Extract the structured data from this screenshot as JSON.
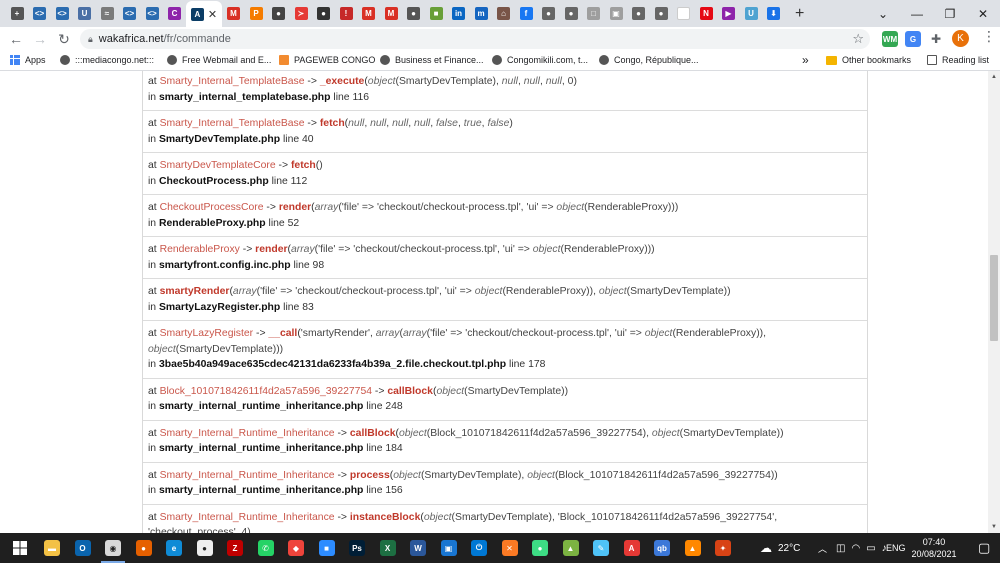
{
  "browser": {
    "active_tab_label": "",
    "tabs": [
      {
        "icon": "tab-icon",
        "color": "#555555",
        "glyph": "+"
      },
      {
        "icon": "code-icon",
        "color": "#2b6cb0",
        "glyph": "<>"
      },
      {
        "icon": "code-icon",
        "color": "#2b6cb0",
        "glyph": "<>"
      },
      {
        "icon": "shield-icon",
        "color": "#4a6fa5",
        "glyph": "U"
      },
      {
        "icon": "cloud-icon",
        "color": "#7a7a7a",
        "glyph": "≈"
      },
      {
        "icon": "code-icon",
        "color": "#2b6cb0",
        "glyph": "<>"
      },
      {
        "icon": "code-icon",
        "color": "#2b6cb0",
        "glyph": "<>"
      },
      {
        "icon": "gradient-icon",
        "color": "#8e24aa",
        "glyph": "C"
      },
      {
        "icon": "azure-icon",
        "color": "#0b3d66",
        "glyph": "A"
      },
      {
        "icon": "gmail-icon",
        "color": "#d93025",
        "glyph": "M"
      },
      {
        "icon": "orange-icon",
        "color": "#f57c00",
        "glyph": "P"
      },
      {
        "icon": "circle-icon",
        "color": "#444444",
        "glyph": "●"
      },
      {
        "icon": "bird-icon",
        "color": "#e53935",
        "glyph": "≻"
      },
      {
        "icon": "circle-icon",
        "color": "#333333",
        "glyph": "●"
      },
      {
        "icon": "red-circle-icon",
        "color": "#c62828",
        "glyph": "!"
      },
      {
        "icon": "gmail-icon",
        "color": "#d93025",
        "glyph": "M"
      },
      {
        "icon": "gmail-icon",
        "color": "#d93025",
        "glyph": "M"
      },
      {
        "icon": "circle-icon",
        "color": "#555555",
        "glyph": "●"
      },
      {
        "icon": "green-square-icon",
        "color": "#689f38",
        "glyph": "■"
      },
      {
        "icon": "linkedin-icon",
        "color": "#0a66c2",
        "glyph": "in"
      },
      {
        "icon": "m-icon",
        "color": "#1565c0",
        "glyph": "m"
      },
      {
        "icon": "house-icon",
        "color": "#795548",
        "glyph": "⌂"
      },
      {
        "icon": "facebook-icon",
        "color": "#1877f2",
        "glyph": "f"
      },
      {
        "icon": "circle-icon",
        "color": "#666666",
        "glyph": "●"
      },
      {
        "icon": "circle-icon",
        "color": "#666666",
        "glyph": "●"
      },
      {
        "icon": "doc-icon",
        "color": "#9e9e9e",
        "glyph": "□"
      },
      {
        "icon": "doc-icon",
        "color": "#9e9e9e",
        "glyph": "▣"
      },
      {
        "icon": "circle-icon",
        "color": "#666666",
        "glyph": "●"
      },
      {
        "icon": "circle-icon",
        "color": "#666666",
        "glyph": "●"
      },
      {
        "icon": "blank-icon",
        "color": "#ffffff",
        "glyph": ""
      },
      {
        "icon": "netflix-icon",
        "color": "#e50914",
        "glyph": "N"
      },
      {
        "icon": "play-icon",
        "color": "#8e24aa",
        "glyph": "▶"
      },
      {
        "icon": "u-icon",
        "color": "#4fa3d1",
        "glyph": "U"
      },
      {
        "icon": "download-icon",
        "color": "#1a73e8",
        "glyph": "⬇"
      }
    ],
    "new_tab_label": "+",
    "url_host": "wakafrica.net",
    "url_path": "/fr/commande",
    "avatar_letter": "K"
  },
  "bookmarks": [
    {
      "label": "Apps",
      "icon": "apps-icon"
    },
    {
      "label": ":::mediacongo.net:::",
      "icon": "globe-icon"
    },
    {
      "label": "Free Webmail and E...",
      "icon": "globe-icon"
    },
    {
      "label": "PAGEWEB CONGO",
      "icon": "pageweb-icon"
    },
    {
      "label": "Business et Finance...",
      "icon": "globe-icon"
    },
    {
      "label": "Congomikili.com, t...",
      "icon": "globe-icon"
    },
    {
      "label": "Congo, République...",
      "icon": "globe-icon"
    }
  ],
  "bookmarks_overflow": "»",
  "other_bookmarks": "Other bookmarks",
  "reading_list": "Reading list",
  "trace": [
    {
      "at": "at",
      "cls": "Smarty_Internal_TemplateBase",
      "arrow": "->",
      "fn": "_execute",
      "args": [
        {
          "t": "i",
          "v": "object"
        },
        {
          "t": "n",
          "v": "(SmartyDevTemplate), "
        },
        {
          "t": "i",
          "v": "null"
        },
        {
          "t": "n",
          "v": ", "
        },
        {
          "t": "i",
          "v": "null"
        },
        {
          "t": "n",
          "v": ", "
        },
        {
          "t": "i",
          "v": "null"
        },
        {
          "t": "n",
          "v": ", 0)"
        }
      ],
      "in": "in",
      "file": "smarty_internal_templatebase.php",
      "line": "line 116"
    },
    {
      "at": "at",
      "cls": "Smarty_Internal_TemplateBase",
      "arrow": "->",
      "fn": "fetch",
      "args": [
        {
          "t": "i",
          "v": "null"
        },
        {
          "t": "n",
          "v": ", "
        },
        {
          "t": "i",
          "v": "null"
        },
        {
          "t": "n",
          "v": ", "
        },
        {
          "t": "i",
          "v": "null"
        },
        {
          "t": "n",
          "v": ", "
        },
        {
          "t": "i",
          "v": "null"
        },
        {
          "t": "n",
          "v": ", "
        },
        {
          "t": "i",
          "v": "false"
        },
        {
          "t": "n",
          "v": ", "
        },
        {
          "t": "i",
          "v": "true"
        },
        {
          "t": "n",
          "v": ", "
        },
        {
          "t": "i",
          "v": "false"
        },
        {
          "t": "n",
          "v": ")"
        }
      ],
      "in": "in",
      "file": "SmartyDevTemplate.php",
      "line": "line 40"
    },
    {
      "at": "at",
      "cls": "SmartyDevTemplateCore",
      "arrow": "->",
      "fn": "fetch",
      "args": [
        {
          "t": "n",
          "v": ")"
        }
      ],
      "in": "in",
      "file": "CheckoutProcess.php",
      "line": "line 112"
    },
    {
      "at": "at",
      "cls": "CheckoutProcessCore",
      "arrow": "->",
      "fn": "render",
      "args": [
        {
          "t": "i",
          "v": "array"
        },
        {
          "t": "n",
          "v": "('file' => 'checkout/checkout-process.tpl', 'ui' => "
        },
        {
          "t": "i",
          "v": "object"
        },
        {
          "t": "n",
          "v": "(RenderableProxy)))"
        }
      ],
      "in": "in",
      "file": "RenderableProxy.php",
      "line": "line 52"
    },
    {
      "at": "at",
      "cls": "RenderableProxy",
      "arrow": "->",
      "fn": "render",
      "args": [
        {
          "t": "i",
          "v": "array"
        },
        {
          "t": "n",
          "v": "('file' => 'checkout/checkout-process.tpl', 'ui' => "
        },
        {
          "t": "i",
          "v": "object"
        },
        {
          "t": "n",
          "v": "(RenderableProxy)))"
        }
      ],
      "in": "in",
      "file": "smartyfront.config.inc.php",
      "line": "line 98"
    },
    {
      "at": "at",
      "cls": "",
      "arrow": "",
      "fn": "smartyRender",
      "args": [
        {
          "t": "i",
          "v": "array"
        },
        {
          "t": "n",
          "v": "('file' => 'checkout/checkout-process.tpl', 'ui' => "
        },
        {
          "t": "i",
          "v": "object"
        },
        {
          "t": "n",
          "v": "(RenderableProxy)), "
        },
        {
          "t": "i",
          "v": "object"
        },
        {
          "t": "n",
          "v": "(SmartyDevTemplate))"
        }
      ],
      "in": "in",
      "file": "SmartyLazyRegister.php",
      "line": "line 83"
    },
    {
      "at": "at",
      "cls": "SmartyLazyRegister",
      "arrow": "->",
      "fn": "__call",
      "args": [
        {
          "t": "n",
          "v": "'smartyRender', "
        },
        {
          "t": "i",
          "v": "array"
        },
        {
          "t": "n",
          "v": "("
        },
        {
          "t": "i",
          "v": "array"
        },
        {
          "t": "n",
          "v": "('file' => 'checkout/checkout-process.tpl', 'ui' => "
        },
        {
          "t": "i",
          "v": "object"
        },
        {
          "t": "n",
          "v": "(RenderableProxy)), "
        },
        {
          "t": "i",
          "v": "object"
        },
        {
          "t": "n",
          "v": "(SmartyDevTemplate)))"
        }
      ],
      "in": "in",
      "file": "3bae5b40a949ace635cdec42131da6233fa4b39a_2.file.checkout.tpl.php",
      "line": "line 178"
    },
    {
      "at": "at",
      "cls": "Block_101071842611f4d2a57a596_39227754",
      "arrow": "->",
      "fn": "callBlock",
      "args": [
        {
          "t": "i",
          "v": "object"
        },
        {
          "t": "n",
          "v": "(SmartyDevTemplate))"
        }
      ],
      "in": "in",
      "file": "smarty_internal_runtime_inheritance.php",
      "line": "line 248"
    },
    {
      "at": "at",
      "cls": "Smarty_Internal_Runtime_Inheritance",
      "arrow": "->",
      "fn": "callBlock",
      "args": [
        {
          "t": "i",
          "v": "object"
        },
        {
          "t": "n",
          "v": "(Block_101071842611f4d2a57a596_39227754), "
        },
        {
          "t": "i",
          "v": "object"
        },
        {
          "t": "n",
          "v": "(SmartyDevTemplate))"
        }
      ],
      "in": "in",
      "file": "smarty_internal_runtime_inheritance.php",
      "line": "line 184"
    },
    {
      "at": "at",
      "cls": "Smarty_Internal_Runtime_Inheritance",
      "arrow": "->",
      "fn": "process",
      "args": [
        {
          "t": "i",
          "v": "object"
        },
        {
          "t": "n",
          "v": "(SmartyDevTemplate), "
        },
        {
          "t": "i",
          "v": "object"
        },
        {
          "t": "n",
          "v": "(Block_101071842611f4d2a57a596_39227754))"
        }
      ],
      "in": "in",
      "file": "smarty_internal_runtime_inheritance.php",
      "line": "line 156"
    },
    {
      "at": "at",
      "cls": "Smarty_Internal_Runtime_Inheritance",
      "arrow": "->",
      "fn": "instanceBlock",
      "args": [
        {
          "t": "i",
          "v": "object"
        },
        {
          "t": "n",
          "v": "(SmartyDevTemplate), 'Block_101071842611f4d2a57a596_39227754', 'checkout_process', 4)"
        }
      ],
      "in": "",
      "file": "",
      "line": ""
    }
  ],
  "taskbar": {
    "apps": [
      {
        "name": "file-explorer-icon",
        "color": "#f3c145",
        "glyph": "▬"
      },
      {
        "name": "outlook-icon",
        "color": "#0a64ad",
        "glyph": "O"
      },
      {
        "name": "chrome-icon",
        "color": "#d9d9d9",
        "glyph": "◉",
        "running": true
      },
      {
        "name": "firefox-icon",
        "color": "#e66000",
        "glyph": "●"
      },
      {
        "name": "edge-icon",
        "color": "#0f8bd6",
        "glyph": "e"
      },
      {
        "name": "github-icon",
        "color": "#eeeeee",
        "glyph": "●"
      },
      {
        "name": "filezilla-icon",
        "color": "#bf0000",
        "glyph": "Z"
      },
      {
        "name": "whatsapp-icon",
        "color": "#25d366",
        "glyph": "✆"
      },
      {
        "name": "anydesk-icon",
        "color": "#ef443b",
        "glyph": "◆"
      },
      {
        "name": "zoom-icon",
        "color": "#2d8cff",
        "glyph": "■"
      },
      {
        "name": "photoshop-icon",
        "color": "#001e36",
        "glyph": "Ps"
      },
      {
        "name": "excel-icon",
        "color": "#1d6f42",
        "glyph": "X"
      },
      {
        "name": "word-icon",
        "color": "#2b579a",
        "glyph": "W"
      },
      {
        "name": "capture-icon",
        "color": "#1976d2",
        "glyph": "▣"
      },
      {
        "name": "power-icon",
        "color": "#0078d4",
        "glyph": "⏻"
      },
      {
        "name": "xampp-icon",
        "color": "#fb7a24",
        "glyph": "✕"
      },
      {
        "name": "android-icon",
        "color": "#3ddc84",
        "glyph": "●"
      },
      {
        "name": "image-icon",
        "color": "#7cb342",
        "glyph": "▲"
      },
      {
        "name": "notes-icon",
        "color": "#4fc3f7",
        "glyph": "✎"
      },
      {
        "name": "pdf-icon",
        "color": "#e53935",
        "glyph": "A"
      },
      {
        "name": "qb-icon",
        "color": "#3c78d8",
        "glyph": "qb"
      },
      {
        "name": "vlc-icon",
        "color": "#ff8800",
        "glyph": "▲"
      },
      {
        "name": "tool-icon",
        "color": "#d84315",
        "glyph": "✦"
      }
    ],
    "weather_temp": "22°C",
    "language": "ENG",
    "time": "07:40",
    "date": "20/08/2021"
  }
}
